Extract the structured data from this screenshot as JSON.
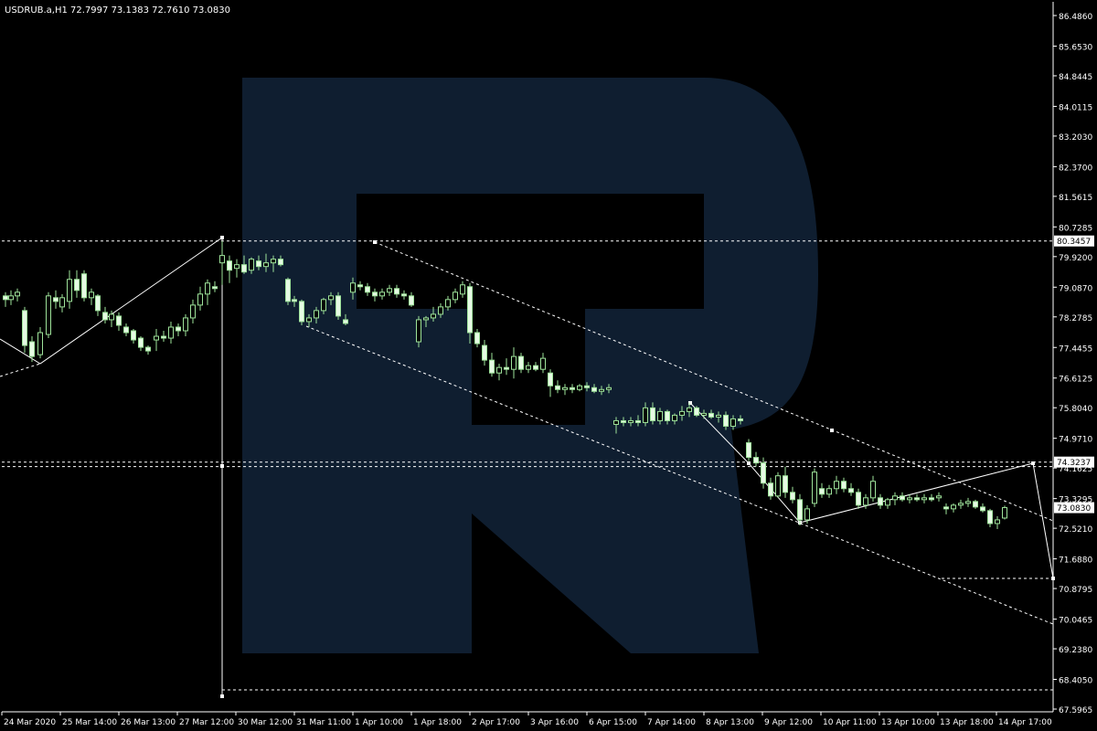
{
  "window": {
    "symbol_header": "USDRUB.a,H1  72.7997 73.1383 72.7610 73.0830"
  },
  "watermark": {
    "icon": "rtbroker-r-logo",
    "color": "#0f1e30"
  },
  "colors": {
    "background": "#000000",
    "frame": "#ffffff",
    "candle": "#9ee39a",
    "candle_fill": "#e6fbe4",
    "lines": "#ffffff",
    "price_box_bg": "#ffffff",
    "price_box_text": "#000000"
  },
  "chart_data": {
    "type": "candlestick",
    "title": "USDRUB.a,H1",
    "ylim": [
      67.5965,
      86.486
    ],
    "y_ticks": [
      "86.4860",
      "85.6530",
      "84.8445",
      "84.0115",
      "83.2030",
      "82.3700",
      "81.5615",
      "80.7285",
      "79.9200",
      "79.0870",
      "78.2785",
      "77.4455",
      "76.6125",
      "75.8040",
      "74.9710",
      "74.1625",
      "73.3295",
      "72.5210",
      "71.6880",
      "70.8795",
      "70.0465",
      "69.2380",
      "68.4050",
      "67.5965"
    ],
    "x_labels": [
      "24 Mar 2020",
      "25 Mar 14:00",
      "26 Mar 13:00",
      "27 Mar 12:00",
      "30 Mar 12:00",
      "31 Mar 11:00",
      "1 Apr 10:00",
      "1 Apr 18:00",
      "2 Apr 17:00",
      "3 Apr 16:00",
      "6 Apr 15:00",
      "7 Apr 14:00",
      "8 Apr 13:00",
      "9 Apr 12:00",
      "10 Apr 11:00",
      "13 Apr 10:00",
      "13 Apr 18:00",
      "14 Apr 17:00"
    ],
    "price_labels": {
      "upper_level": "80.3457",
      "lower_level": "74.3237",
      "current": "73.0830"
    },
    "levels": [
      {
        "name": "upper-horizontal-level",
        "y": 80.3457
      },
      {
        "name": "lower-horizontal-level",
        "y": 74.3237
      },
      {
        "name": "lower-horizontal-level-2",
        "y": 74.2
      },
      {
        "name": "bottom-target-level",
        "y": 68.12
      },
      {
        "name": "right-target-level",
        "y": 71.22
      }
    ],
    "candles": [
      {
        "x": 6,
        "o": 78.85,
        "h": 78.95,
        "l": 78.55,
        "c": 78.75
      },
      {
        "x": 12,
        "o": 78.75,
        "h": 79.0,
        "l": 78.6,
        "c": 78.85
      },
      {
        "x": 19,
        "o": 78.85,
        "h": 79.05,
        "l": 78.7,
        "c": 78.95
      },
      {
        "x": 27,
        "o": 78.45,
        "h": 78.55,
        "l": 77.3,
        "c": 77.5
      },
      {
        "x": 35,
        "o": 77.6,
        "h": 77.75,
        "l": 77.05,
        "c": 77.2
      },
      {
        "x": 44,
        "o": 77.25,
        "h": 78.0,
        "l": 77.15,
        "c": 77.85
      },
      {
        "x": 53,
        "o": 77.8,
        "h": 78.95,
        "l": 77.7,
        "c": 78.85
      },
      {
        "x": 61,
        "o": 78.8,
        "h": 79.0,
        "l": 78.5,
        "c": 78.7
      },
      {
        "x": 68,
        "o": 78.55,
        "h": 78.9,
        "l": 78.4,
        "c": 78.8
      },
      {
        "x": 76,
        "o": 78.7,
        "h": 79.55,
        "l": 78.5,
        "c": 79.3
      },
      {
        "x": 84,
        "o": 79.3,
        "h": 79.55,
        "l": 78.8,
        "c": 79.0
      },
      {
        "x": 92,
        "o": 79.45,
        "h": 79.55,
        "l": 78.7,
        "c": 78.8
      },
      {
        "x": 100,
        "o": 78.8,
        "h": 79.05,
        "l": 78.6,
        "c": 78.95
      },
      {
        "x": 107,
        "o": 78.85,
        "h": 78.9,
        "l": 78.3,
        "c": 78.45
      },
      {
        "x": 115,
        "o": 78.4,
        "h": 78.55,
        "l": 78.1,
        "c": 78.2
      },
      {
        "x": 122,
        "o": 78.2,
        "h": 78.45,
        "l": 78.0,
        "c": 78.35
      },
      {
        "x": 130,
        "o": 78.3,
        "h": 78.4,
        "l": 77.9,
        "c": 78.05
      },
      {
        "x": 138,
        "o": 78.0,
        "h": 78.1,
        "l": 77.75,
        "c": 77.85
      },
      {
        "x": 146,
        "o": 77.9,
        "h": 77.95,
        "l": 77.55,
        "c": 77.65
      },
      {
        "x": 154,
        "o": 77.7,
        "h": 77.75,
        "l": 77.35,
        "c": 77.45
      },
      {
        "x": 162,
        "o": 77.45,
        "h": 77.5,
        "l": 77.25,
        "c": 77.35
      },
      {
        "x": 171,
        "o": 77.65,
        "h": 77.95,
        "l": 77.35,
        "c": 77.75
      },
      {
        "x": 179,
        "o": 77.75,
        "h": 77.9,
        "l": 77.6,
        "c": 77.7
      },
      {
        "x": 187,
        "o": 77.7,
        "h": 78.15,
        "l": 77.55,
        "c": 78.0
      },
      {
        "x": 195,
        "o": 78.0,
        "h": 78.1,
        "l": 77.75,
        "c": 77.9
      },
      {
        "x": 203,
        "o": 77.9,
        "h": 78.35,
        "l": 77.75,
        "c": 78.25
      },
      {
        "x": 211,
        "o": 78.25,
        "h": 78.75,
        "l": 78.1,
        "c": 78.6
      },
      {
        "x": 219,
        "o": 78.6,
        "h": 79.1,
        "l": 78.45,
        "c": 78.9
      },
      {
        "x": 227,
        "o": 78.9,
        "h": 79.3,
        "l": 78.6,
        "c": 79.2
      },
      {
        "x": 235,
        "o": 79.1,
        "h": 79.25,
        "l": 78.95,
        "c": 79.05
      },
      {
        "x": 243,
        "o": 79.75,
        "h": 80.3457,
        "l": 79.15,
        "c": 79.95
      },
      {
        "x": 251,
        "o": 79.8,
        "h": 79.95,
        "l": 79.2,
        "c": 79.55
      },
      {
        "x": 259,
        "o": 79.6,
        "h": 79.85,
        "l": 79.35,
        "c": 79.7
      },
      {
        "x": 267,
        "o": 79.7,
        "h": 79.95,
        "l": 79.45,
        "c": 79.5
      },
      {
        "x": 275,
        "o": 79.55,
        "h": 79.9,
        "l": 79.45,
        "c": 79.85
      },
      {
        "x": 283,
        "o": 79.8,
        "h": 79.95,
        "l": 79.55,
        "c": 79.65
      },
      {
        "x": 291,
        "o": 79.65,
        "h": 80.0,
        "l": 79.5,
        "c": 79.75
      },
      {
        "x": 299,
        "o": 79.75,
        "h": 79.95,
        "l": 79.5,
        "c": 79.85
      },
      {
        "x": 307,
        "o": 79.85,
        "h": 79.95,
        "l": 79.65,
        "c": 79.7
      },
      {
        "x": 315,
        "o": 79.3,
        "h": 79.35,
        "l": 78.6,
        "c": 78.7
      },
      {
        "x": 322,
        "o": 78.75,
        "h": 78.85,
        "l": 78.55,
        "c": 78.7
      },
      {
        "x": 330,
        "o": 78.7,
        "h": 78.75,
        "l": 78.05,
        "c": 78.15
      },
      {
        "x": 338,
        "o": 78.15,
        "h": 78.35,
        "l": 78.0,
        "c": 78.25
      },
      {
        "x": 346,
        "o": 78.25,
        "h": 78.55,
        "l": 78.1,
        "c": 78.45
      },
      {
        "x": 354,
        "o": 78.45,
        "h": 78.8,
        "l": 78.35,
        "c": 78.75
      },
      {
        "x": 362,
        "o": 78.75,
        "h": 78.95,
        "l": 78.6,
        "c": 78.85
      },
      {
        "x": 370,
        "o": 78.85,
        "h": 78.95,
        "l": 78.2,
        "c": 78.3
      },
      {
        "x": 378,
        "o": 78.2,
        "h": 78.35,
        "l": 78.05,
        "c": 78.1
      },
      {
        "x": 386,
        "o": 78.95,
        "h": 79.35,
        "l": 78.75,
        "c": 79.2
      },
      {
        "x": 394,
        "o": 79.15,
        "h": 79.25,
        "l": 79.0,
        "c": 79.1
      },
      {
        "x": 402,
        "o": 79.1,
        "h": 79.2,
        "l": 78.85,
        "c": 78.95
      },
      {
        "x": 410,
        "o": 78.95,
        "h": 79.05,
        "l": 78.7,
        "c": 78.85
      },
      {
        "x": 418,
        "o": 78.85,
        "h": 79.05,
        "l": 78.75,
        "c": 78.95
      },
      {
        "x": 426,
        "o": 78.95,
        "h": 79.15,
        "l": 78.85,
        "c": 79.05
      },
      {
        "x": 434,
        "o": 79.05,
        "h": 79.15,
        "l": 78.8,
        "c": 78.9
      },
      {
        "x": 442,
        "o": 78.9,
        "h": 79.0,
        "l": 78.75,
        "c": 78.85
      },
      {
        "x": 450,
        "o": 78.85,
        "h": 78.95,
        "l": 78.55,
        "c": 78.6
      },
      {
        "x": 458,
        "o": 77.6,
        "h": 78.3,
        "l": 77.45,
        "c": 78.2
      },
      {
        "x": 466,
        "o": 78.2,
        "h": 78.3,
        "l": 78.0,
        "c": 78.25
      },
      {
        "x": 474,
        "o": 78.25,
        "h": 78.55,
        "l": 78.15,
        "c": 78.35
      },
      {
        "x": 482,
        "o": 78.35,
        "h": 78.65,
        "l": 78.25,
        "c": 78.55
      },
      {
        "x": 490,
        "o": 78.55,
        "h": 78.85,
        "l": 78.45,
        "c": 78.75
      },
      {
        "x": 498,
        "o": 78.75,
        "h": 79.05,
        "l": 78.65,
        "c": 78.95
      },
      {
        "x": 506,
        "o": 78.9,
        "h": 79.25,
        "l": 78.8,
        "c": 79.15
      },
      {
        "x": 514,
        "o": 79.1,
        "h": 79.2,
        "l": 77.55,
        "c": 77.85
      },
      {
        "x": 522,
        "o": 77.85,
        "h": 77.95,
        "l": 77.45,
        "c": 77.55
      },
      {
        "x": 530,
        "o": 77.5,
        "h": 77.65,
        "l": 76.95,
        "c": 77.1
      },
      {
        "x": 538,
        "o": 77.1,
        "h": 77.3,
        "l": 76.65,
        "c": 76.75
      },
      {
        "x": 546,
        "o": 76.75,
        "h": 77.0,
        "l": 76.55,
        "c": 76.9
      },
      {
        "x": 554,
        "o": 76.9,
        "h": 77.15,
        "l": 76.7,
        "c": 76.85
      },
      {
        "x": 562,
        "o": 76.85,
        "h": 77.45,
        "l": 76.6,
        "c": 77.2
      },
      {
        "x": 570,
        "o": 77.2,
        "h": 77.3,
        "l": 76.75,
        "c": 76.85
      },
      {
        "x": 578,
        "o": 76.85,
        "h": 77.05,
        "l": 76.75,
        "c": 76.95
      },
      {
        "x": 586,
        "o": 76.95,
        "h": 77.05,
        "l": 76.8,
        "c": 76.85
      },
      {
        "x": 594,
        "o": 76.85,
        "h": 77.3,
        "l": 76.75,
        "c": 77.15
      },
      {
        "x": 602,
        "o": 76.75,
        "h": 76.85,
        "l": 76.1,
        "c": 76.4
      },
      {
        "x": 610,
        "o": 76.4,
        "h": 76.55,
        "l": 76.2,
        "c": 76.3
      },
      {
        "x": 618,
        "o": 76.3,
        "h": 76.45,
        "l": 76.15,
        "c": 76.35
      },
      {
        "x": 626,
        "o": 76.35,
        "h": 76.45,
        "l": 76.2,
        "c": 76.3
      },
      {
        "x": 634,
        "o": 76.3,
        "h": 76.45,
        "l": 76.25,
        "c": 76.4
      },
      {
        "x": 642,
        "o": 76.4,
        "h": 76.5,
        "l": 76.25,
        "c": 76.35
      },
      {
        "x": 650,
        "o": 76.35,
        "h": 76.45,
        "l": 76.2,
        "c": 76.25
      },
      {
        "x": 658,
        "o": 76.25,
        "h": 76.4,
        "l": 76.15,
        "c": 76.3
      },
      {
        "x": 666,
        "o": 76.3,
        "h": 76.45,
        "l": 76.2,
        "c": 76.35
      },
      {
        "x": 674,
        "o": 75.35,
        "h": 75.55,
        "l": 75.1,
        "c": 75.45
      },
      {
        "x": 682,
        "o": 75.45,
        "h": 75.55,
        "l": 75.3,
        "c": 75.4
      },
      {
        "x": 690,
        "o": 75.4,
        "h": 75.55,
        "l": 75.3,
        "c": 75.45
      },
      {
        "x": 698,
        "o": 75.45,
        "h": 75.6,
        "l": 75.3,
        "c": 75.4
      },
      {
        "x": 706,
        "o": 75.4,
        "h": 75.95,
        "l": 75.3,
        "c": 75.8
      },
      {
        "x": 714,
        "o": 75.8,
        "h": 75.95,
        "l": 75.35,
        "c": 75.45
      },
      {
        "x": 722,
        "o": 75.45,
        "h": 75.8,
        "l": 75.35,
        "c": 75.7
      },
      {
        "x": 730,
        "o": 75.7,
        "h": 75.75,
        "l": 75.35,
        "c": 75.45
      },
      {
        "x": 738,
        "o": 75.45,
        "h": 75.65,
        "l": 75.35,
        "c": 75.6
      },
      {
        "x": 746,
        "o": 75.6,
        "h": 75.85,
        "l": 75.45,
        "c": 75.7
      },
      {
        "x": 754,
        "o": 75.7,
        "h": 75.95,
        "l": 75.55,
        "c": 75.8
      },
      {
        "x": 762,
        "o": 75.8,
        "h": 75.85,
        "l": 75.55,
        "c": 75.6
      },
      {
        "x": 770,
        "o": 75.6,
        "h": 75.75,
        "l": 75.5,
        "c": 75.65
      },
      {
        "x": 778,
        "o": 75.65,
        "h": 75.75,
        "l": 75.5,
        "c": 75.55
      },
      {
        "x": 786,
        "o": 75.55,
        "h": 75.7,
        "l": 75.4,
        "c": 75.6
      },
      {
        "x": 794,
        "o": 75.6,
        "h": 75.7,
        "l": 75.2,
        "c": 75.3
      },
      {
        "x": 802,
        "o": 75.3,
        "h": 75.6,
        "l": 75.2,
        "c": 75.5
      },
      {
        "x": 810,
        "o": 75.5,
        "h": 75.6,
        "l": 75.35,
        "c": 75.45
      },
      {
        "x": 819,
        "o": 74.85,
        "h": 74.95,
        "l": 74.35,
        "c": 74.45
      },
      {
        "x": 827,
        "o": 74.45,
        "h": 74.6,
        "l": 74.2,
        "c": 74.3
      },
      {
        "x": 835,
        "o": 74.3,
        "h": 74.45,
        "l": 73.6,
        "c": 73.75
      },
      {
        "x": 843,
        "o": 73.75,
        "h": 73.9,
        "l": 73.3,
        "c": 73.4
      },
      {
        "x": 851,
        "o": 73.4,
        "h": 74.05,
        "l": 73.35,
        "c": 73.95
      },
      {
        "x": 859,
        "o": 73.95,
        "h": 74.2,
        "l": 73.35,
        "c": 73.5
      },
      {
        "x": 867,
        "o": 73.5,
        "h": 73.65,
        "l": 73.2,
        "c": 73.3
      },
      {
        "x": 875,
        "o": 73.3,
        "h": 73.45,
        "l": 72.6,
        "c": 72.75
      },
      {
        "x": 883,
        "o": 72.75,
        "h": 73.15,
        "l": 72.65,
        "c": 73.05
      },
      {
        "x": 891,
        "o": 73.2,
        "h": 74.15,
        "l": 73.1,
        "c": 74.05
      },
      {
        "x": 899,
        "o": 73.6,
        "h": 73.75,
        "l": 73.35,
        "c": 73.45
      },
      {
        "x": 907,
        "o": 73.45,
        "h": 73.7,
        "l": 73.35,
        "c": 73.6
      },
      {
        "x": 915,
        "o": 73.6,
        "h": 73.95,
        "l": 73.45,
        "c": 73.8
      },
      {
        "x": 923,
        "o": 73.8,
        "h": 73.9,
        "l": 73.5,
        "c": 73.6
      },
      {
        "x": 931,
        "o": 73.6,
        "h": 73.75,
        "l": 73.4,
        "c": 73.5
      },
      {
        "x": 939,
        "o": 73.5,
        "h": 73.6,
        "l": 73.05,
        "c": 73.15
      },
      {
        "x": 947,
        "o": 73.15,
        "h": 73.45,
        "l": 73.05,
        "c": 73.35
      },
      {
        "x": 955,
        "o": 73.35,
        "h": 73.95,
        "l": 73.25,
        "c": 73.8
      },
      {
        "x": 963,
        "o": 73.35,
        "h": 73.45,
        "l": 73.05,
        "c": 73.15
      },
      {
        "x": 971,
        "o": 73.15,
        "h": 73.35,
        "l": 73.05,
        "c": 73.3
      },
      {
        "x": 979,
        "o": 73.3,
        "h": 73.5,
        "l": 73.15,
        "c": 73.4
      },
      {
        "x": 987,
        "o": 73.4,
        "h": 73.5,
        "l": 73.25,
        "c": 73.3
      },
      {
        "x": 995,
        "o": 73.3,
        "h": 73.45,
        "l": 73.2,
        "c": 73.35
      },
      {
        "x": 1003,
        "o": 73.35,
        "h": 73.45,
        "l": 73.25,
        "c": 73.3
      },
      {
        "x": 1011,
        "o": 73.3,
        "h": 73.45,
        "l": 73.2,
        "c": 73.35
      },
      {
        "x": 1019,
        "o": 73.35,
        "h": 73.45,
        "l": 73.25,
        "c": 73.3
      },
      {
        "x": 1027,
        "o": 73.35,
        "h": 73.5,
        "l": 73.25,
        "c": 73.4
      },
      {
        "x": 1035,
        "o": 73.1,
        "h": 73.2,
        "l": 72.9,
        "c": 73.05
      },
      {
        "x": 1043,
        "o": 73.05,
        "h": 73.2,
        "l": 72.95,
        "c": 73.15
      },
      {
        "x": 1051,
        "o": 73.15,
        "h": 73.3,
        "l": 73.05,
        "c": 73.2
      },
      {
        "x": 1059,
        "o": 73.2,
        "h": 73.35,
        "l": 73.1,
        "c": 73.25
      },
      {
        "x": 1067,
        "o": 73.25,
        "h": 73.3,
        "l": 73.05,
        "c": 73.1
      },
      {
        "x": 1075,
        "o": 73.1,
        "h": 73.2,
        "l": 72.95,
        "c": 73.0
      },
      {
        "x": 1083,
        "o": 73.0,
        "h": 73.05,
        "l": 72.55,
        "c": 72.65
      },
      {
        "x": 1091,
        "o": 72.65,
        "h": 72.85,
        "l": 72.5,
        "c": 72.75
      },
      {
        "x": 1099,
        "o": 72.7997,
        "h": 73.1383,
        "l": 72.761,
        "c": 73.083
      }
    ]
  }
}
